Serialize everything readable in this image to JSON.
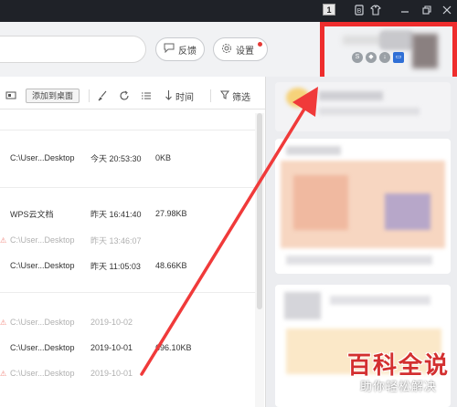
{
  "titlebar": {
    "badge": "1",
    "icons": [
      "skin-icon",
      "shirt-icon",
      "minimize-icon",
      "restore-icon",
      "close-icon"
    ]
  },
  "header": {
    "feedback_label": "反馈",
    "settings_label": "设置"
  },
  "toolbar": {
    "add_desktop_label": "添加到桌面",
    "time_label": "时间",
    "filter_label": "筛选"
  },
  "files": [
    {
      "path": "C:\\User...Desktop",
      "time": "今天 20:53:30",
      "size": "0KB",
      "dim": false,
      "warn": false
    },
    {
      "path": "WPS云文档",
      "time": "昨天 16:41:40",
      "size": "27.98KB",
      "dim": false,
      "warn": false
    },
    {
      "path": "C:\\User...Desktop",
      "time": "昨天 13:46:07",
      "size": "",
      "dim": true,
      "warn": true
    },
    {
      "path": "C:\\User...Desktop",
      "time": "昨天 11:05:03",
      "size": "48.66KB",
      "dim": false,
      "warn": false
    },
    {
      "path": "C:\\User...Desktop",
      "time": "2019-10-02",
      "size": "",
      "dim": true,
      "warn": true
    },
    {
      "path": "C:\\User...Desktop",
      "time": "2019-10-01",
      "size": "696.10KB",
      "dim": false,
      "warn": false
    },
    {
      "path": "C:\\User...Desktop",
      "time": "2019-10-01",
      "size": "",
      "dim": true,
      "warn": true
    }
  ],
  "watermark": {
    "main": "百科全说",
    "sub": "助你轻松解决"
  },
  "colors": {
    "highlight": "#ee2d2d",
    "titlebar": "#1f2228",
    "watermark": "#d32f2f"
  }
}
